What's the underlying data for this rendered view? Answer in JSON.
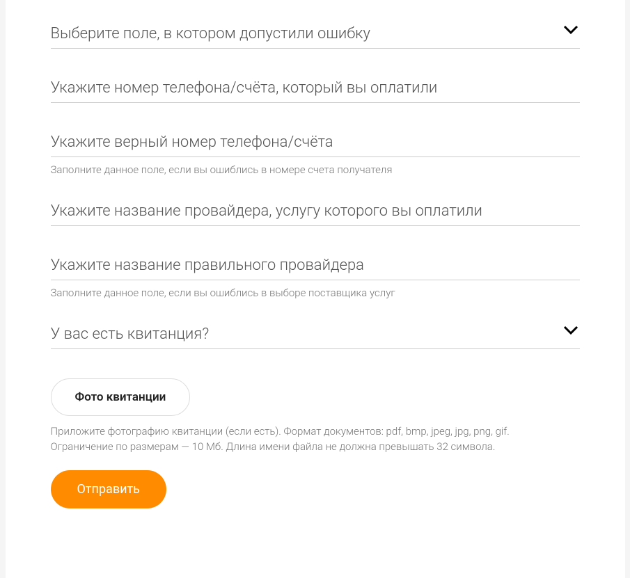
{
  "fields": {
    "error_field": {
      "label": "Выберите поле, в котором допустили ошибку"
    },
    "paid_phone": {
      "placeholder": "Укажите номер телефона/счёта, который вы оплатили"
    },
    "correct_phone": {
      "placeholder": "Укажите верный номер телефона/счёта",
      "helper": "Заполните данное поле, если вы ошиблись в номере счета получателя"
    },
    "paid_provider": {
      "placeholder": "Укажите название провайдера, услугу которого вы оплатили"
    },
    "correct_provider": {
      "placeholder": "Укажите название правильного провайдера",
      "helper": "Заполните данное поле, если вы ошиблись в выборе поставщика услуг"
    },
    "has_receipt": {
      "label": "У вас есть квитанция?"
    }
  },
  "upload": {
    "button_label": "Фото квитанции",
    "helper": "Приложите фотографию квитанции (если есть). Формат документов: pdf, bmp, jpeg, jpg, png, gif. Ограничение по размерам — 10 Мб. Длина имени файла не должна превышать 32 символа."
  },
  "submit": {
    "label": "Отправить"
  }
}
